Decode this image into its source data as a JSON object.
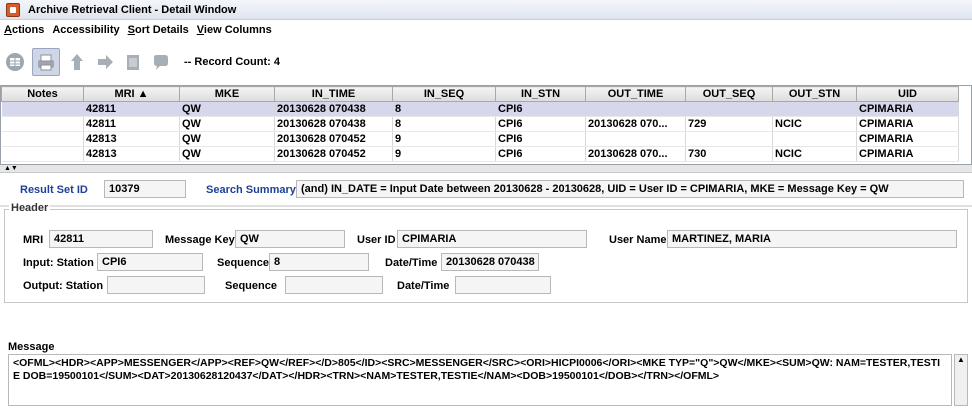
{
  "window": {
    "title": "Archive Retrieval Client - Detail Window"
  },
  "menu": {
    "items": [
      {
        "first": "A",
        "rest": "ctions"
      },
      {
        "first": "",
        "rest": "Accessibility"
      },
      {
        "first": "S",
        "rest": "ort Details"
      },
      {
        "first": "V",
        "rest": "iew Columns"
      }
    ]
  },
  "toolbar": {
    "record_count": "-- Record Count: 4"
  },
  "grid": {
    "columns": [
      "Notes",
      "MRI ▲",
      "MKE",
      "IN_TIME",
      "IN_SEQ",
      "IN_STN",
      "OUT_TIME",
      "OUT_SEQ",
      "OUT_STN",
      "UID"
    ],
    "rows": [
      [
        "",
        "42811",
        "QW",
        "20130628 070438",
        "8",
        "CPI6",
        "",
        "",
        "",
        "CPIMARIA"
      ],
      [
        "",
        "42811",
        "QW",
        "20130628 070438",
        "8",
        "CPI6",
        "20130628 070...",
        "729",
        "NCIC",
        "CPIMARIA"
      ],
      [
        "",
        "42813",
        "QW",
        "20130628 070452",
        "9",
        "CPI6",
        "",
        "",
        "",
        "CPIMARIA"
      ],
      [
        "",
        "42813",
        "QW",
        "20130628 070452",
        "9",
        "CPI6",
        "20130628 070...",
        "730",
        "NCIC",
        "CPIMARIA"
      ]
    ]
  },
  "splitter": {
    "arrows": "▲▼"
  },
  "result": {
    "set_id_label": "Result Set ID",
    "set_id_value": "10379",
    "summary_label": "Search Summary",
    "summary_value": "(and) IN_DATE = Input Date between 20130628 - 20130628, UID = User ID = CPIMARIA, MKE = Message Key = QW"
  },
  "header": {
    "legend": "Header",
    "mri_label": "MRI",
    "mri_value": "42811",
    "message_key_label": "Message Key",
    "message_key_value": "QW",
    "user_id_label": "User ID",
    "user_id_value": "CPIMARIA",
    "user_name_label": "User Name",
    "user_name_value": "MARTINEZ, MARIA",
    "input_station_label": "Input:  Station",
    "input_station_value": "CPI6",
    "input_sequence_label": "Sequence",
    "input_sequence_value": "8",
    "input_datetime_label": "Date/Time",
    "input_datetime_value": "20130628 070438",
    "output_station_label": "Output:  Station",
    "output_station_value": "",
    "output_sequence_label": "Sequence",
    "output_sequence_value": "",
    "output_datetime_label": "Date/Time",
    "output_datetime_value": ""
  },
  "message": {
    "label": "Message",
    "text": "<OFML><HDR><APP>MESSENGER</APP><REF>QW</REF></D>805</ID><SRC>MESSENGER</SRC><ORI>HICPI0006</ORI><MKE TYP=\"Q\">QW</MKE><SUM>QW: NAM=TESTER,TESTIE DOB=19500101</SUM><DAT>20130628120437</DAT></HDR><TRN><NAM>TESTER,TESTIE</NAM><DOB>19500101</DOB></TRN></OFML>"
  }
}
